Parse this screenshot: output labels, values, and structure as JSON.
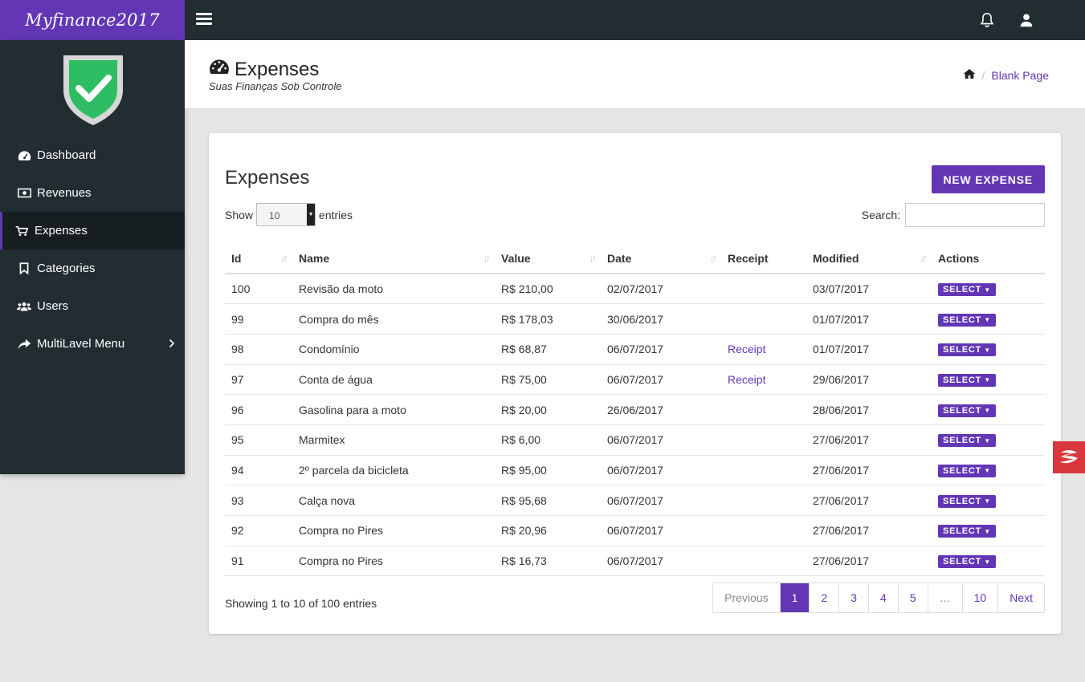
{
  "app": {
    "brand": "Myfinance2017"
  },
  "sidebar": {
    "items": [
      {
        "label": "Dashboard",
        "icon": "dashboard-icon"
      },
      {
        "label": "Revenues",
        "icon": "money-icon"
      },
      {
        "label": "Expenses",
        "icon": "cart-icon",
        "active": true
      },
      {
        "label": "Categories",
        "icon": "bookmark-icon"
      },
      {
        "label": "Users",
        "icon": "users-icon"
      },
      {
        "label": "MultiLavel Menu",
        "icon": "share-icon"
      }
    ]
  },
  "header": {
    "title": "Expenses",
    "subtitle": "Suas Finanças Sob Controle",
    "breadcrumb_current": "Blank Page"
  },
  "card": {
    "title": "Expenses",
    "new_button": "NEW EXPENSE",
    "show_label": "Show",
    "entries_label": "entries",
    "page_length": "10",
    "search_label": "Search:",
    "search_value": ""
  },
  "table": {
    "columns": [
      "Id",
      "Name",
      "Value",
      "Date",
      "Receipt",
      "Modified",
      "Actions"
    ],
    "action_label": "SELECT",
    "rows": [
      {
        "id": "100",
        "name": "Revisão da moto",
        "value": "R$ 210,00",
        "date": "02/07/2017",
        "receipt": "",
        "modified": "03/07/2017"
      },
      {
        "id": "99",
        "name": "Compra do mês",
        "value": "R$ 178,03",
        "date": "30/06/2017",
        "receipt": "",
        "modified": "01/07/2017"
      },
      {
        "id": "98",
        "name": "Condomínio",
        "value": "R$ 68,87",
        "date": "06/07/2017",
        "receipt": "Receipt",
        "modified": "01/07/2017"
      },
      {
        "id": "97",
        "name": "Conta de água",
        "value": "R$ 75,00",
        "date": "06/07/2017",
        "receipt": "Receipt",
        "modified": "29/06/2017"
      },
      {
        "id": "96",
        "name": "Gasolina para a moto",
        "value": "R$ 20,00",
        "date": "26/06/2017",
        "receipt": "",
        "modified": "28/06/2017"
      },
      {
        "id": "95",
        "name": "Marmitex",
        "value": "R$ 6,00",
        "date": "06/07/2017",
        "receipt": "",
        "modified": "27/06/2017"
      },
      {
        "id": "94",
        "name": "2º parcela da bicicleta",
        "value": "R$ 95,00",
        "date": "06/07/2017",
        "receipt": "",
        "modified": "27/06/2017"
      },
      {
        "id": "93",
        "name": "Calça nova",
        "value": "R$ 95,68",
        "date": "06/07/2017",
        "receipt": "",
        "modified": "27/06/2017"
      },
      {
        "id": "92",
        "name": "Compra no Pires",
        "value": "R$ 20,96",
        "date": "06/07/2017",
        "receipt": "",
        "modified": "27/06/2017"
      },
      {
        "id": "91",
        "name": "Compra no Pires",
        "value": "R$ 16,73",
        "date": "06/07/2017",
        "receipt": "",
        "modified": "27/06/2017"
      }
    ]
  },
  "footer": {
    "info": "Showing 1 to 10 of 100 entries",
    "pagination": [
      "Previous",
      "1",
      "2",
      "3",
      "4",
      "5",
      "…",
      "10",
      "Next"
    ],
    "active_page": "1"
  },
  "colors": {
    "accent": "#6236b5",
    "sidebar_bg": "#222d32",
    "badge_red": "#d9373d",
    "shield_green": "#2ebd62"
  }
}
